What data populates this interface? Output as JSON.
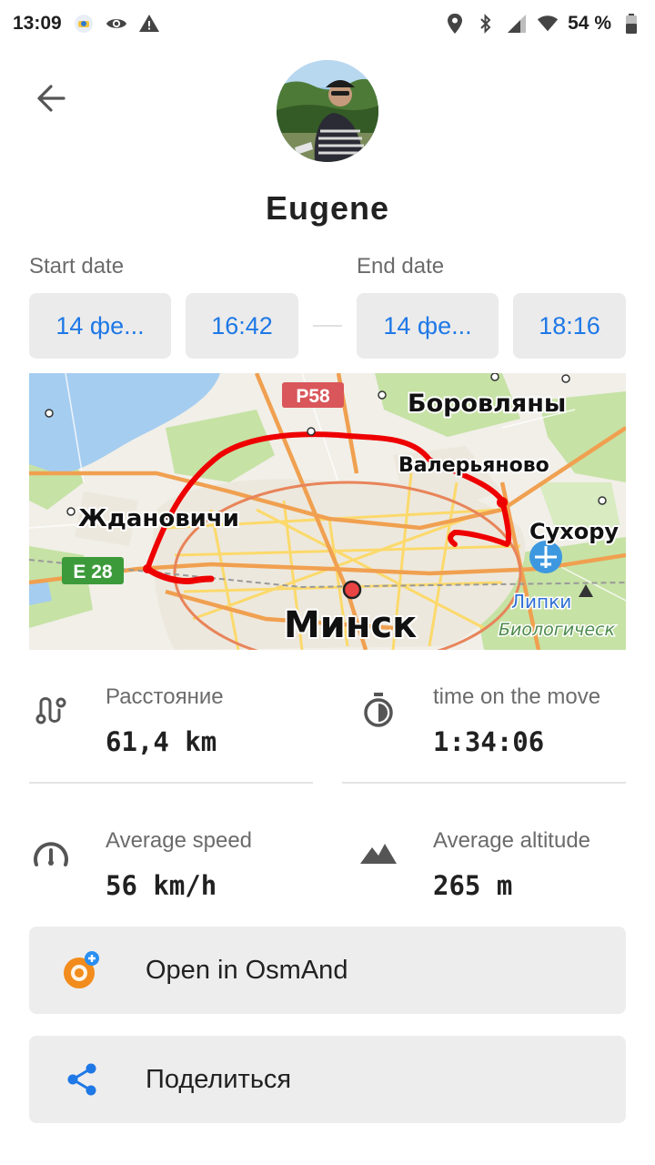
{
  "status_bar": {
    "time": "13:09",
    "battery": "54 %",
    "icons_left": [
      "app-notification-icon",
      "eye-icon",
      "warning-icon"
    ],
    "icons_right": [
      "location-icon",
      "bluetooth-icon",
      "signal-icon",
      "wifi-icon",
      "battery-icon"
    ]
  },
  "profile": {
    "name": "Eugene"
  },
  "dates": {
    "start_label": "Start date",
    "end_label": "End date",
    "start_date": "14 фе...",
    "start_time": "16:42",
    "end_date": "14 фе...",
    "end_time": "18:16"
  },
  "map": {
    "labels": {
      "road_p58": "P58",
      "road_e28": "E 28",
      "borovlyany": "Боровляны",
      "valeryanovo": "Валерьяново",
      "zhdanovichi": "Ждановичи",
      "sukhoru": "Сухору",
      "minsk": "Минск",
      "lipki": "Липки",
      "biolog": "Биологическ"
    },
    "colors": {
      "water": "#a5cdf0",
      "forest": "#c6e2a5",
      "city": "#ede8dd",
      "track": "#ee0000",
      "major_road": "#f0a050",
      "minor_road": "#fbd96b"
    }
  },
  "stats": {
    "distance": {
      "label": "Расстояние",
      "value": "61,4 km",
      "icon": "route-icon"
    },
    "time_moving": {
      "label": "time on the move",
      "value": "1:34:06",
      "icon": "stopwatch-icon"
    },
    "avg_speed": {
      "label": "Average speed",
      "value": "56 km/h",
      "icon": "speedometer-icon"
    },
    "avg_altitude": {
      "label": "Average altitude",
      "value": "265 m",
      "icon": "mountain-icon"
    }
  },
  "actions": {
    "open_osmand": {
      "label": "Open in OsmAnd",
      "icon": "osmand-icon"
    },
    "share": {
      "label": "Поделиться",
      "icon": "share-icon"
    }
  },
  "colors": {
    "accent": "#1e78e6",
    "chip_bg": "#ebebeb",
    "button_bg": "#ededed",
    "secondary_text": "#6b6b6b"
  }
}
